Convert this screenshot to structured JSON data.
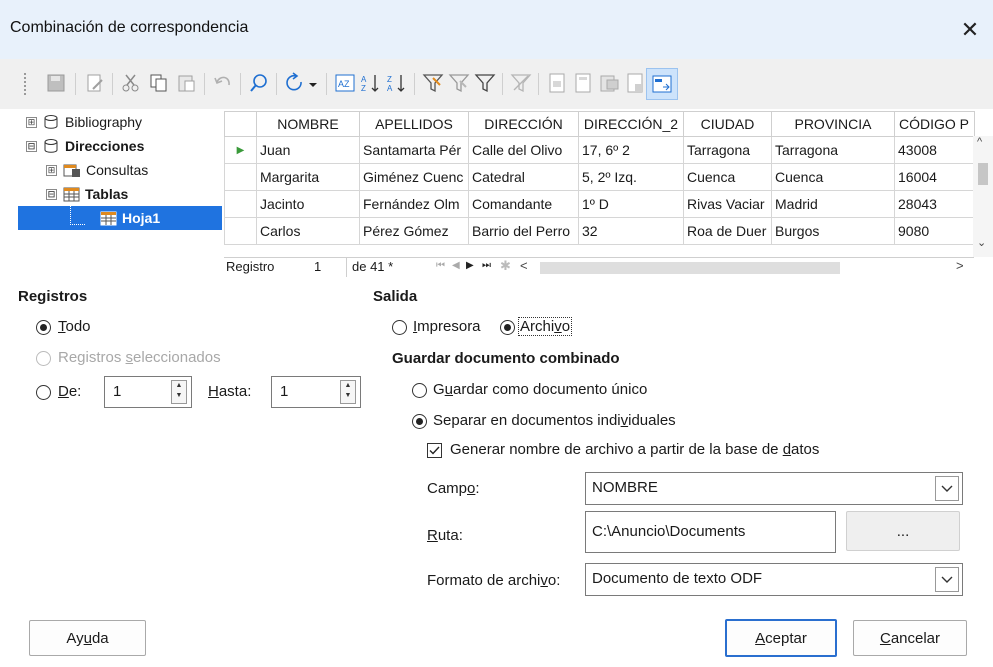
{
  "window": {
    "title": "Combinación de correspondencia"
  },
  "toolbar": {
    "icons": [
      "save-icon",
      "edit-icon",
      "cut-icon",
      "copy-icon",
      "paste-icon",
      "undo-icon",
      "find-icon",
      "refresh-icon",
      "dropdown-icon",
      "autofilter-icon",
      "sort-ascending-icon",
      "sort-descending-icon",
      "standard-filter-icon",
      "apply-filter-icon",
      "filter-icon",
      "remove-filter-icon",
      "data-to-text-icon",
      "data-to-fields-icon",
      "mail-merge-icon",
      "data-source-icon",
      "explorer-toggle-icon"
    ]
  },
  "tree": {
    "items": [
      {
        "label": "Bibliography",
        "expander": "⊞",
        "icon": "database-icon",
        "indent": 0,
        "bold": false
      },
      {
        "label": "Direcciones",
        "expander": "⊟",
        "icon": "database-icon",
        "indent": 0,
        "bold": true
      },
      {
        "label": "Consultas",
        "expander": "⊞",
        "icon": "queries-icon",
        "indent": 1,
        "bold": false
      },
      {
        "label": "Tablas",
        "expander": "⊟",
        "icon": "tables-icon",
        "indent": 1,
        "bold": true
      },
      {
        "label": "Hoja1",
        "expander": "",
        "icon": "table-icon",
        "indent": 2,
        "bold": true,
        "selected": true
      }
    ]
  },
  "grid": {
    "columns": [
      "NOMBRE",
      "APELLIDOS",
      "DIRECCIÓN",
      "DIRECCIÓN_2",
      "CIUDAD",
      "PROVINCIA",
      "CÓDIGO P"
    ],
    "rows": [
      [
        "Juan",
        "Santamarta Pér",
        "Calle del Olivo",
        "17, 6º 2",
        "Tarragona",
        "Tarragona",
        "43008"
      ],
      [
        "Margarita",
        "Giménez Cuenc",
        "Catedral",
        "5, 2º Izq.",
        "Cuenca",
        "Cuenca",
        "16004"
      ],
      [
        "Jacinto",
        "Fernández Olm",
        "Comandante",
        "1º D",
        "Rivas Vaciar",
        "Madrid",
        "28043"
      ],
      [
        "Carlos",
        "Pérez Gómez",
        "Barrio del Perro",
        "32",
        "Roa de Duer",
        "Burgos",
        "9080"
      ]
    ],
    "nav": {
      "label": "Registro",
      "current": "1",
      "total": "de 41 *"
    }
  },
  "registros": {
    "heading": "Registros",
    "todo": "Todo",
    "seleccionados": "Registros seleccionados",
    "de_label": "De:",
    "de_value": "1",
    "hasta_label": "Hasta:",
    "hasta_value": "1"
  },
  "salida": {
    "heading": "Salida",
    "impresora": "Impresora",
    "archivo": "Archivo",
    "guardar_heading": "Guardar documento combinado",
    "unico": "Guardar como documento único",
    "separar": "Separar en documentos individuales",
    "generar": "Generar nombre de archivo a partir de la base de datos",
    "campo_label": "Campo:",
    "campo_value": "NOMBRE",
    "ruta_label": "Ruta:",
    "ruta_value": "C:\\Anuncio\\Documents",
    "browse": "...",
    "formato_label": "Formato de archivo:",
    "formato_value": "Documento de texto ODF"
  },
  "buttons": {
    "ayuda": "Ayuda",
    "aceptar": "Aceptar",
    "cancelar": "Cancelar"
  }
}
